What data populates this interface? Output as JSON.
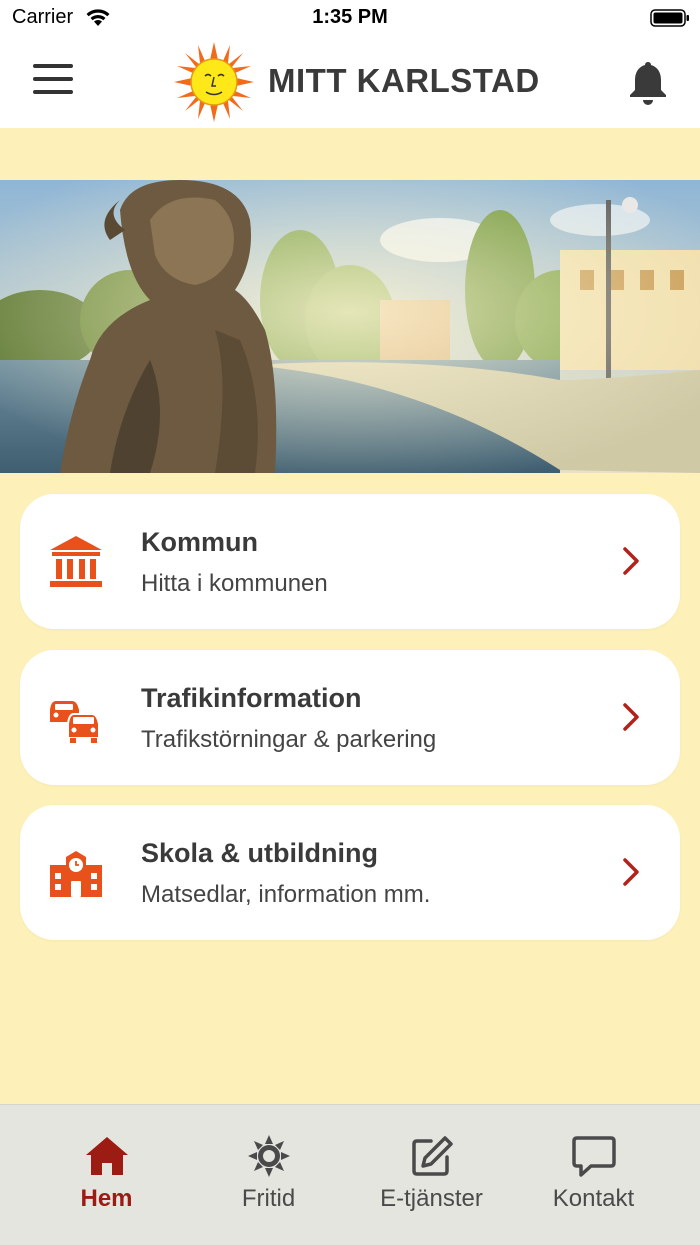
{
  "status_bar": {
    "carrier": "Carrier",
    "time": "1:35 PM"
  },
  "header": {
    "title": "MITT KARLSTAD",
    "menu_icon": "hamburger-menu-icon",
    "notification_icon": "bell-icon",
    "logo_icon": "sun-face-logo"
  },
  "hero": {
    "image": "statue-by-river-photo"
  },
  "cards": [
    {
      "title": "Kommun",
      "subtitle": "Hitta i kommunen",
      "icon": "town-hall-icon"
    },
    {
      "title": "Trafikinformation",
      "subtitle": "Trafikstörningar & parkering",
      "icon": "cars-icon"
    },
    {
      "title": "Skola & utbildning",
      "subtitle": "Matsedlar, information mm.",
      "icon": "school-icon"
    }
  ],
  "tabs": [
    {
      "label": "Hem",
      "icon": "home-icon",
      "active": true
    },
    {
      "label": "Fritid",
      "icon": "sun-icon",
      "active": false
    },
    {
      "label": "E-tjänster",
      "icon": "edit-icon",
      "active": false
    },
    {
      "label": "Kontakt",
      "icon": "chat-icon",
      "active": false
    }
  ],
  "colors": {
    "background": "#fdf0b8",
    "accent_orange": "#e8511c",
    "chevron_red": "#b3221a",
    "active_tab": "#9c1b12"
  }
}
